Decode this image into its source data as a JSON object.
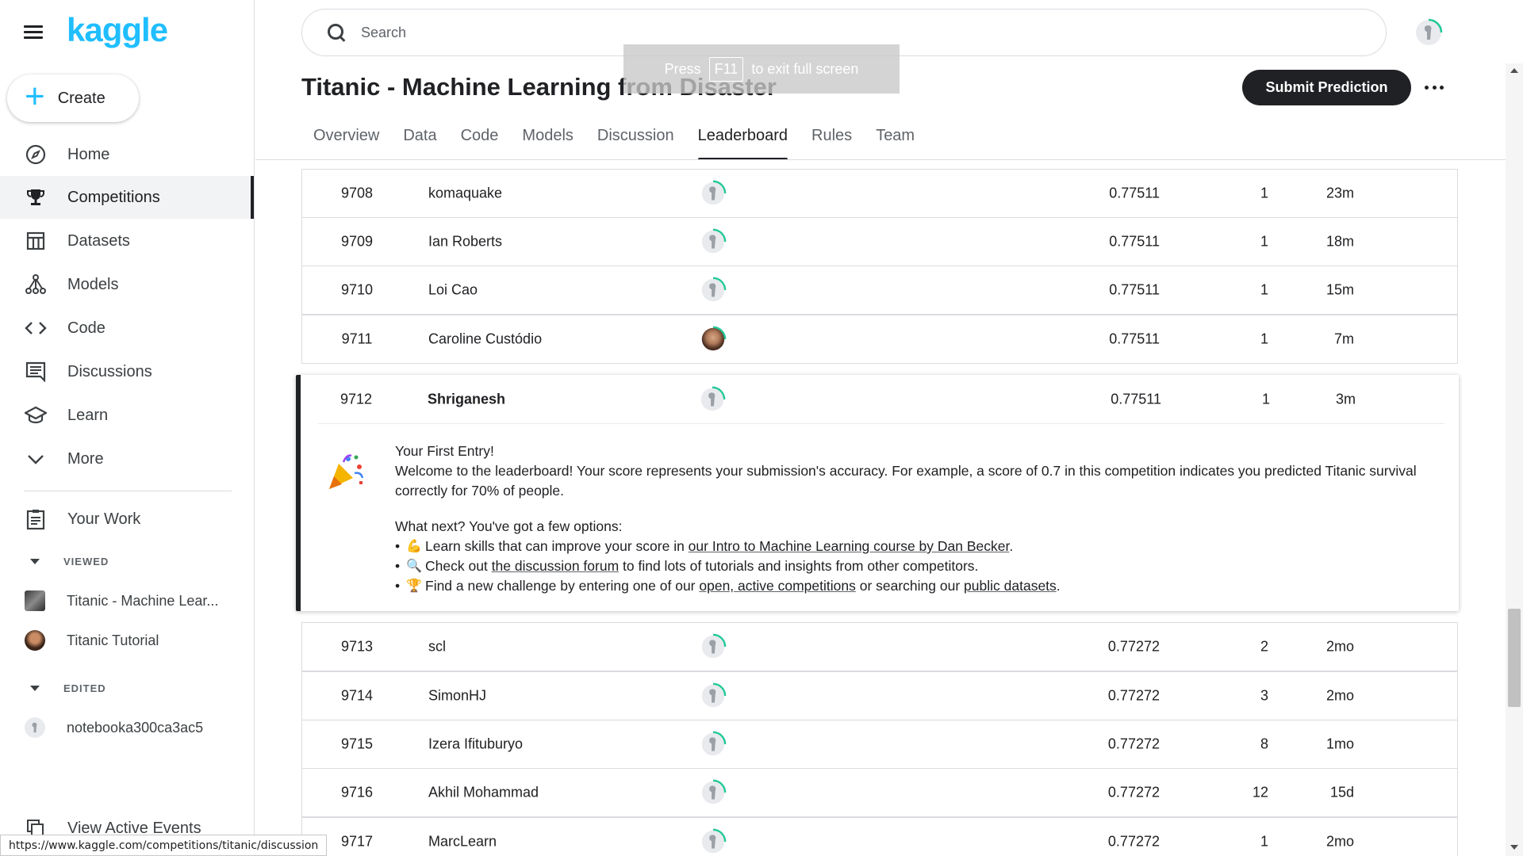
{
  "app": {
    "logo": "kaggle"
  },
  "sidebar": {
    "create_label": "Create",
    "items": [
      {
        "label": "Home",
        "icon": "compass-icon"
      },
      {
        "label": "Competitions",
        "icon": "trophy-icon"
      },
      {
        "label": "Datasets",
        "icon": "table-icon"
      },
      {
        "label": "Models",
        "icon": "models-icon"
      },
      {
        "label": "Code",
        "icon": "code-icon"
      },
      {
        "label": "Discussions",
        "icon": "discussion-icon"
      },
      {
        "label": "Learn",
        "icon": "graduation-cap-icon"
      },
      {
        "label": "More",
        "icon": "chevron-down-icon"
      }
    ],
    "your_work": "Your Work",
    "viewed_header": "VIEWED",
    "viewed": [
      "Titanic - Machine Lear...",
      "Titanic Tutorial"
    ],
    "edited_header": "EDITED",
    "edited": [
      "notebooka300ca3ac5"
    ],
    "view_active_events": "View Active Events"
  },
  "header": {
    "search_placeholder": "Search",
    "fullscreen_hint": {
      "pre": "Press",
      "key": "F11",
      "post": "to exit full screen"
    }
  },
  "competition": {
    "title": "Titanic - Machine Learning from Disaster",
    "submit_label": "Submit Prediction",
    "tabs": [
      "Overview",
      "Data",
      "Code",
      "Models",
      "Discussion",
      "Leaderboard",
      "Rules",
      "Team"
    ],
    "active_tab": "Leaderboard"
  },
  "leaderboard": {
    "rows_before": [
      {
        "rank": "9708",
        "team": "komaquake",
        "score": "0.77511",
        "entries": "1",
        "last": "23m"
      },
      {
        "rank": "9709",
        "team": "Ian Roberts",
        "score": "0.77511",
        "entries": "1",
        "last": "18m"
      },
      {
        "rank": "9710",
        "team": "Loi Cao",
        "score": "0.77511",
        "entries": "1",
        "last": "15m"
      },
      {
        "rank": "9711",
        "team": "Caroline Custódio",
        "score": "0.77511",
        "entries": "1",
        "last": "7m"
      }
    ],
    "my_row": {
      "rank": "9712",
      "team": "Shriganesh",
      "score": "0.77511",
      "entries": "1",
      "last": "3m"
    },
    "first_entry": {
      "heading": "Your First Entry!",
      "welcome": "Welcome to the leaderboard! Your score represents your submission's accuracy. For example, a score of 0.7 in this competition indicates you predicted Titanic survival correctly for 70% of people.",
      "what_next": "What next? You've got a few options:",
      "b1_pre": "Learn skills that can improve your score in ",
      "b1_link": "our Intro to Machine Learning course by Dan Becker",
      "b1_post": ".",
      "b2_pre": "Check out ",
      "b2_link": "the discussion forum",
      "b2_post": " to find lots of tutorials and insights from other competitors.",
      "b3_pre": "Find a new challenge by entering one of our ",
      "b3_link1": "open, active competitions",
      "b3_mid": " or searching our ",
      "b3_link2": "public datasets",
      "b3_post": "."
    },
    "rows_after": [
      {
        "rank": "9713",
        "team": "scl",
        "score": "0.77272",
        "entries": "2",
        "last": "2mo"
      },
      {
        "rank": "9714",
        "team": "SimonHJ",
        "score": "0.77272",
        "entries": "3",
        "last": "2mo"
      },
      {
        "rank": "9715",
        "team": "Izera Ifituburyo",
        "score": "0.77272",
        "entries": "8",
        "last": "1mo"
      },
      {
        "rank": "9716",
        "team": "Akhil Mohammad",
        "score": "0.77272",
        "entries": "12",
        "last": "15d"
      },
      {
        "rank": "9717",
        "team": "MarcLearn",
        "score": "0.77272",
        "entries": "1",
        "last": "2mo"
      }
    ]
  },
  "status_url": "https://www.kaggle.com/competitions/titanic/discussion",
  "colors": {
    "accent": "#20beff",
    "dark": "#202124",
    "progress": "#20c997"
  }
}
